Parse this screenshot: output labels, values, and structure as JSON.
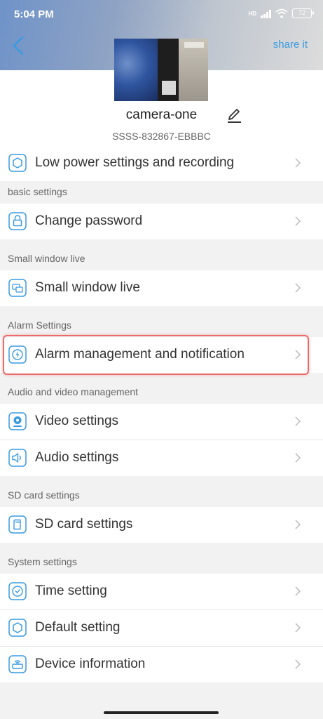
{
  "status_bar": {
    "time": "5:04 PM",
    "network": "HD",
    "battery": "72"
  },
  "header": {
    "back_icon": "chevron-left-icon",
    "share_label": "share it",
    "device_name": "camera-one",
    "device_uid": "SSSS-832867-EBBBC",
    "edit_icon": "pencil-icon"
  },
  "top_item": {
    "label": "Low power settings and recording",
    "icon": "hexagon-icon"
  },
  "sections": {
    "basic": {
      "title": "basic settings",
      "items": [
        {
          "label": "Change password",
          "icon": "lock-icon"
        }
      ]
    },
    "small_window": {
      "title": "Small window live",
      "items": [
        {
          "label": "Small window live",
          "icon": "window-icon"
        }
      ]
    },
    "alarm": {
      "title": "Alarm Settings",
      "items": [
        {
          "label": "Alarm management and notification",
          "icon": "lightning-icon",
          "highlighted": true
        }
      ]
    },
    "av": {
      "title": "Audio and video management",
      "items": [
        {
          "label": "Video settings",
          "icon": "webcam-icon"
        },
        {
          "label": "Audio settings",
          "icon": "speaker-icon"
        }
      ]
    },
    "sd": {
      "title": "SD card settings",
      "items": [
        {
          "label": "SD card settings",
          "icon": "sd-card-icon"
        }
      ]
    },
    "system": {
      "title": "System settings",
      "items": [
        {
          "label": "Time setting",
          "icon": "clock-icon"
        },
        {
          "label": "Default setting",
          "icon": "gear-icon"
        },
        {
          "label": "Device information",
          "icon": "router-icon"
        }
      ]
    }
  },
  "colors": {
    "accent": "#3a9be0",
    "highlight": "#ee6a6a",
    "background": "#f2f2f2"
  }
}
